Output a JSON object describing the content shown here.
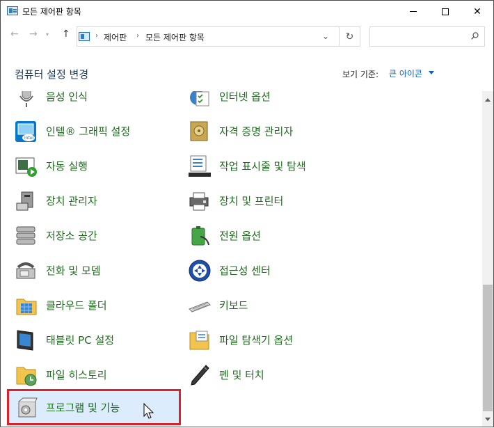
{
  "window": {
    "title": "모든 제어판 항목"
  },
  "address": {
    "crumbs": [
      "제어판",
      "모든 제어판 항목"
    ]
  },
  "header": {
    "title": "컴퓨터 설정 변경",
    "view_label": "보기 기준:",
    "view_value": "큰 아이콘"
  },
  "items": {
    "speech": "음성 인식",
    "internet_options": "인터넷 옵션",
    "intel_graphics": "인텔® 그래픽 설정",
    "credential_manager": "자격 증명 관리자",
    "autoplay": "자동 실행",
    "taskbar": "작업 표시줄 및 탐색",
    "device_manager": "장치 관리자",
    "devices_printers": "장치 및 프린터",
    "storage_spaces": "저장소 공간",
    "power_options": "전원 옵션",
    "phone_modem": "전화 및 모뎀",
    "ease_of_access": "접근성 센터",
    "work_folders": "클라우드 폴더",
    "keyboard": "키보드",
    "tablet_pc": "태블릿 PC 설정",
    "explorer_options": "파일 탐색기 옵션",
    "file_history": "파일 히스토리",
    "pen_touch": "펜 및 터치",
    "programs_features": "프로그램 및 기능"
  },
  "icons": {
    "speech": "microphone-icon",
    "internet_options": "globe-checklist-icon",
    "intel_graphics": "intel-graphics-icon",
    "credential_manager": "safe-vault-icon",
    "autoplay": "autoplay-icon",
    "taskbar": "taskbar-icon",
    "device_manager": "device-manager-icon",
    "devices_printers": "printer-icon",
    "storage_spaces": "storage-disks-icon",
    "power_options": "battery-plug-icon",
    "phone_modem": "phone-modem-icon",
    "ease_of_access": "ease-of-access-icon",
    "work_folders": "cloud-folder-icon",
    "keyboard": "keyboard-icon",
    "tablet_pc": "tablet-pc-icon",
    "explorer_options": "folder-options-icon",
    "file_history": "file-history-icon",
    "pen_touch": "pen-icon",
    "programs_features": "programs-box-icon"
  },
  "colors": {
    "link_green": "#1f6b1f",
    "accent_blue": "#0b64c0",
    "highlight_red": "#d9232c",
    "selection": "#dcecfc"
  }
}
